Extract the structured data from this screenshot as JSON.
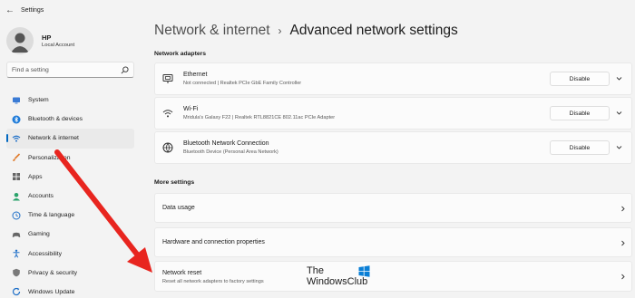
{
  "window": {
    "title": "Settings"
  },
  "profile": {
    "name": "HP",
    "account_type": "Local Account"
  },
  "search": {
    "placeholder": "Find a setting"
  },
  "sidebar": {
    "items": [
      {
        "label": "System",
        "icon": "system-icon"
      },
      {
        "label": "Bluetooth & devices",
        "icon": "bluetooth-icon"
      },
      {
        "label": "Network & internet",
        "icon": "wifi-icon",
        "active": true
      },
      {
        "label": "Personalization",
        "icon": "brush-icon"
      },
      {
        "label": "Apps",
        "icon": "apps-icon"
      },
      {
        "label": "Accounts",
        "icon": "person-icon"
      },
      {
        "label": "Time & language",
        "icon": "globe-clock-icon"
      },
      {
        "label": "Gaming",
        "icon": "gamepad-icon"
      },
      {
        "label": "Accessibility",
        "icon": "accessibility-icon"
      },
      {
        "label": "Privacy & security",
        "icon": "shield-icon"
      },
      {
        "label": "Windows Update",
        "icon": "update-icon"
      }
    ]
  },
  "breadcrumb": {
    "parent": "Network & internet",
    "separator": "›",
    "current": "Advanced network settings"
  },
  "adapters": {
    "heading": "Network adapters",
    "items": [
      {
        "name": "Ethernet",
        "detail": "Not connected | Realtek PCIe GbE Family Controller",
        "action": "Disable",
        "icon": "ethernet-icon"
      },
      {
        "name": "Wi-Fi",
        "detail": "Mridula's Galaxy F22 | Realtek RTL8821CE 802.11ac PCIe Adapter",
        "action": "Disable",
        "icon": "wifi-icon"
      },
      {
        "name": "Bluetooth Network Connection",
        "detail": "Bluetooth Device (Personal Area Network)",
        "action": "Disable",
        "icon": "bluetooth-network-icon"
      }
    ]
  },
  "more_settings": {
    "heading": "More settings",
    "items": [
      {
        "label": "Data usage"
      },
      {
        "label": "Hardware and connection properties"
      },
      {
        "label": "Network reset",
        "detail": "Reset all network adapters to factory settings"
      }
    ]
  },
  "watermark": {
    "line1": "The",
    "line2": "WindowsClub"
  },
  "colors": {
    "accent": "#0067c0",
    "arrow": "#e8251f",
    "background": "#f3f3f3",
    "card": "#fbfbfb"
  }
}
